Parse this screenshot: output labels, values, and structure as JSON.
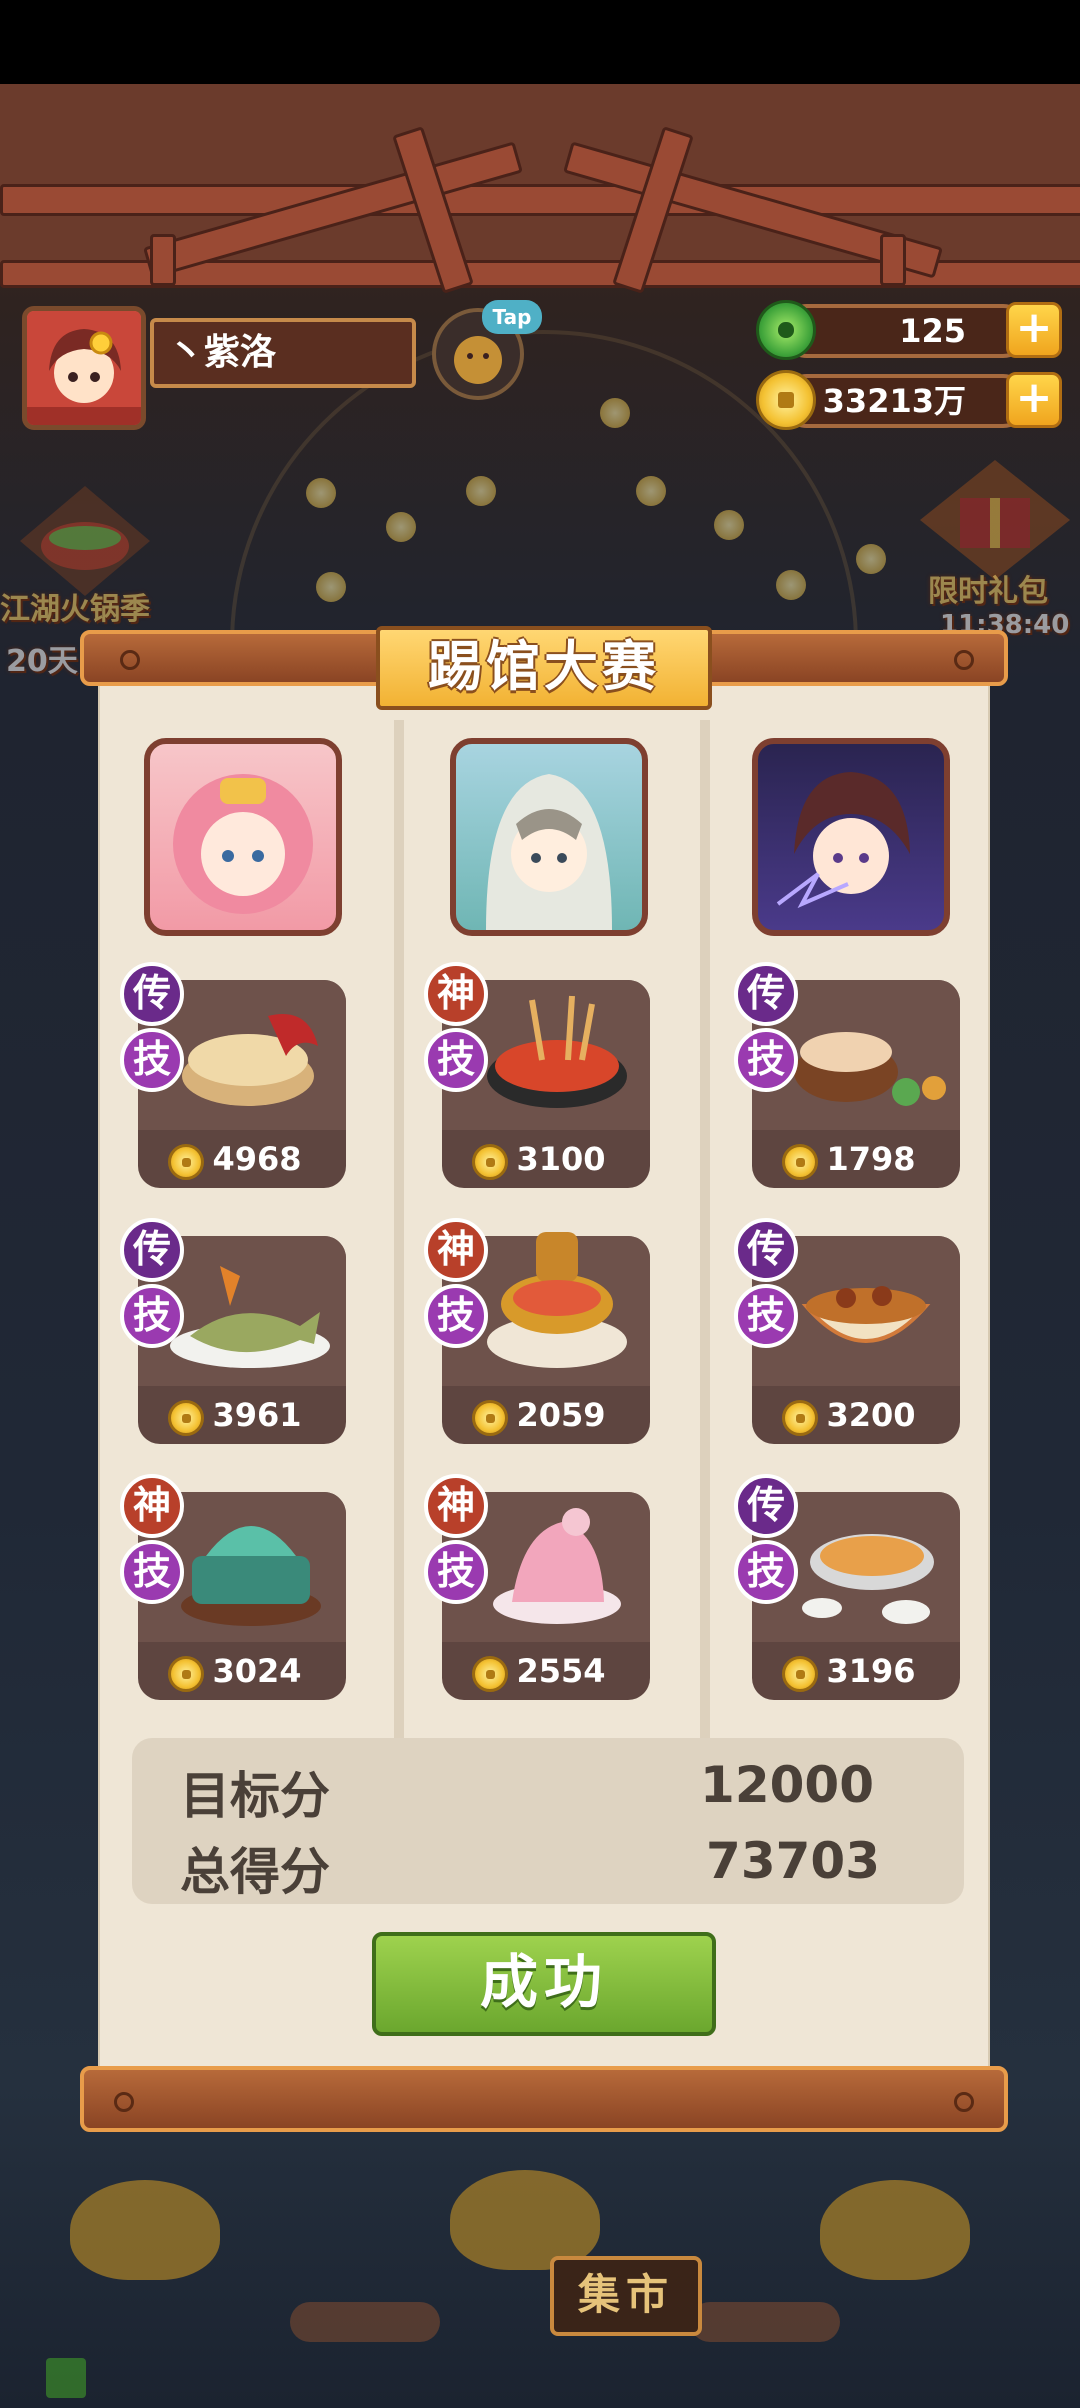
{
  "player": {
    "name": "丶紫洛",
    "tap_label": "Tap"
  },
  "currencies": {
    "jade": "125",
    "coins": "33213万"
  },
  "side_events": {
    "left_label": "江湖火锅季",
    "left_days": "20天",
    "right_label": "限时礼包",
    "right_timer": "11:38:40"
  },
  "modal": {
    "title": "踢馆大赛",
    "columns": [
      {
        "dishes": [
          {
            "rank": "传",
            "skill": "技",
            "score": "4968"
          },
          {
            "rank": "传",
            "skill": "技",
            "score": "3961"
          },
          {
            "rank": "神",
            "skill": "技",
            "score": "3024"
          }
        ]
      },
      {
        "dishes": [
          {
            "rank": "神",
            "skill": "技",
            "score": "3100"
          },
          {
            "rank": "神",
            "skill": "技",
            "score": "2059"
          },
          {
            "rank": "神",
            "skill": "技",
            "score": "2554"
          }
        ]
      },
      {
        "dishes": [
          {
            "rank": "传",
            "skill": "技",
            "score": "1798"
          },
          {
            "rank": "传",
            "skill": "技",
            "score": "3200"
          },
          {
            "rank": "传",
            "skill": "技",
            "score": "3196"
          }
        ]
      }
    ],
    "target_label": "目标分",
    "target_value": "12000",
    "total_label": "总得分",
    "total_value": "73703",
    "result_button": "成功"
  },
  "bottom": {
    "market_label": "集市"
  },
  "colors": {
    "legend_badge": "#6a2a8a",
    "god_badge": "#b8402a",
    "skill_badge": "#9a3ab0",
    "success_green": "#7cb83a"
  }
}
